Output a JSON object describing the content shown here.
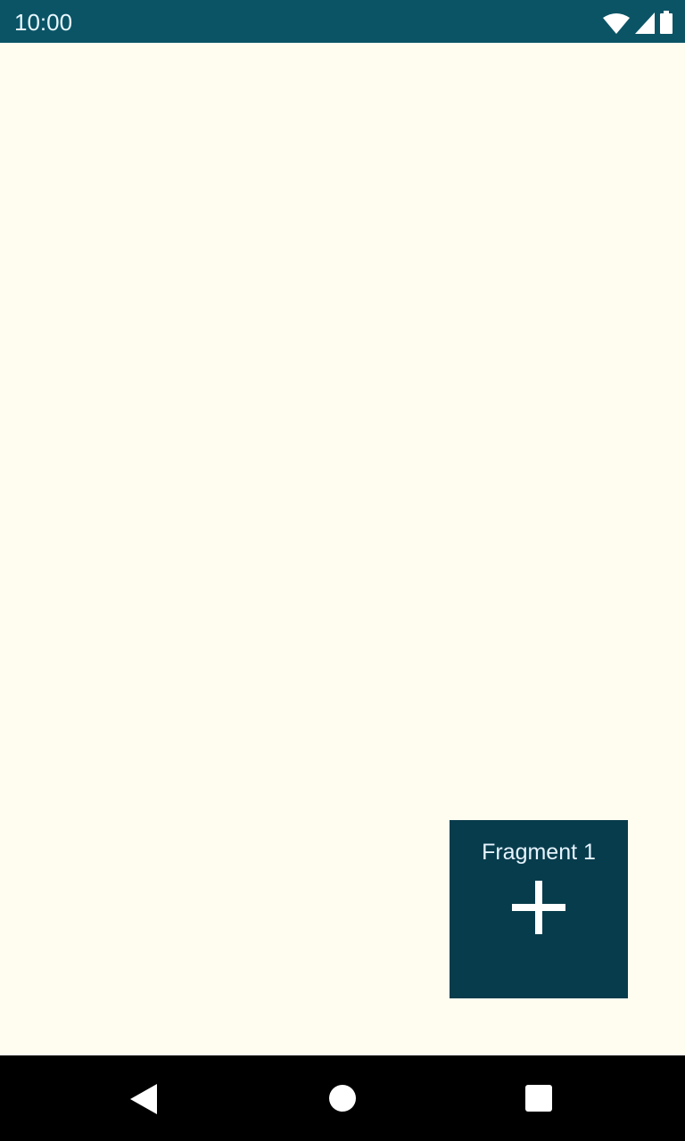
{
  "status_bar": {
    "time": "10:00",
    "icons": [
      "wifi-icon",
      "cellular-signal-icon",
      "battery-icon"
    ]
  },
  "fragment": {
    "label": "Fragment 1",
    "button_icon": "plus-icon"
  },
  "nav_bar": {
    "icons": [
      "back-icon",
      "home-icon",
      "recents-icon"
    ]
  },
  "colors": {
    "status_bar": "#0b5466",
    "fragment_bg": "#073c4c",
    "background": "#fffdf0"
  }
}
